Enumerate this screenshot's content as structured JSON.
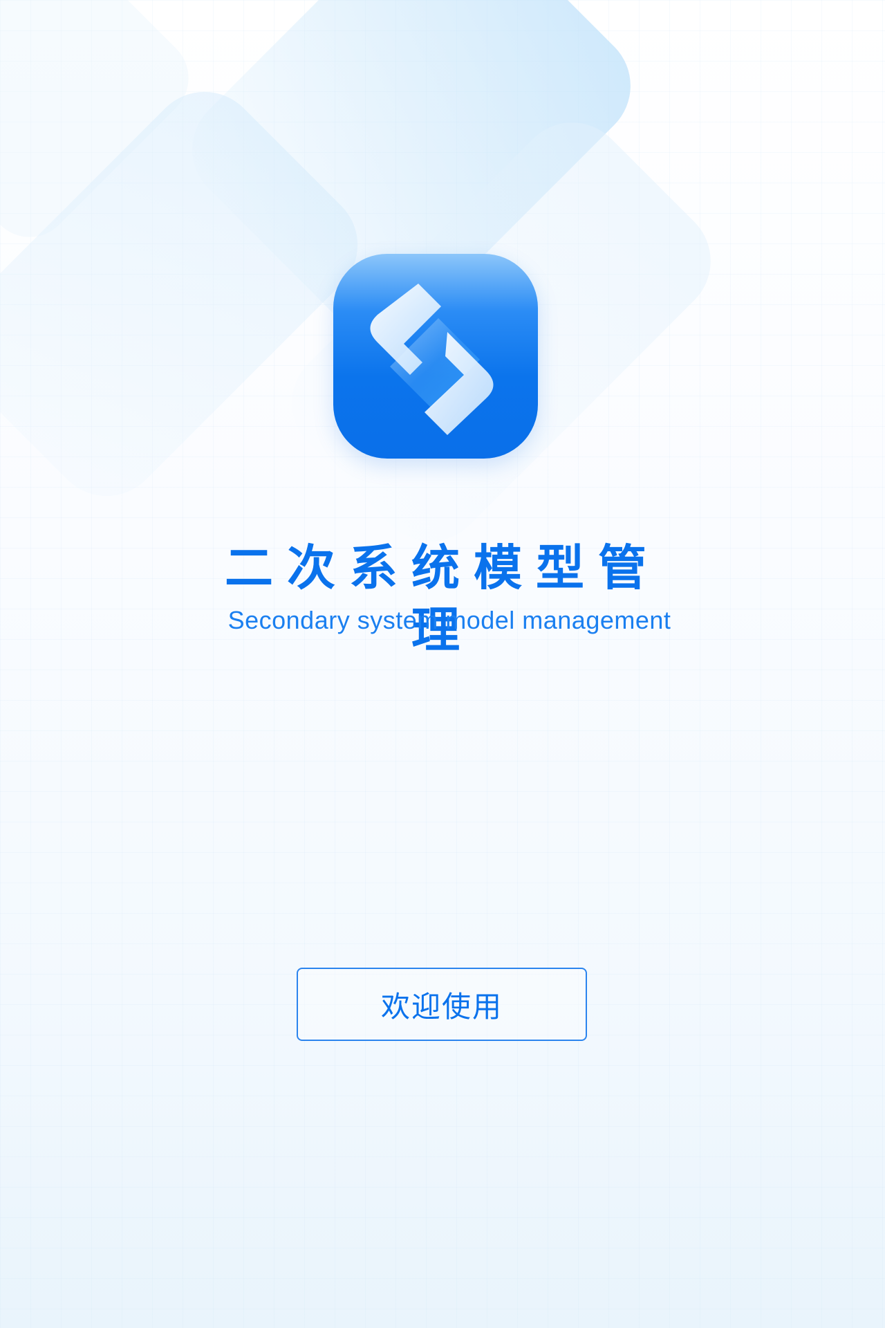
{
  "app": {
    "title_cn": "二次系统模型管理",
    "title_en": "Secondary system model management",
    "logo_icon": "app-logo-icon"
  },
  "welcome_button": {
    "label": "欢迎使用"
  },
  "colors": {
    "brand_blue": "#0a72ec",
    "button_border": "#2b84ee",
    "background_top": "#ffffff",
    "background_bottom": "#e9f4fc"
  }
}
